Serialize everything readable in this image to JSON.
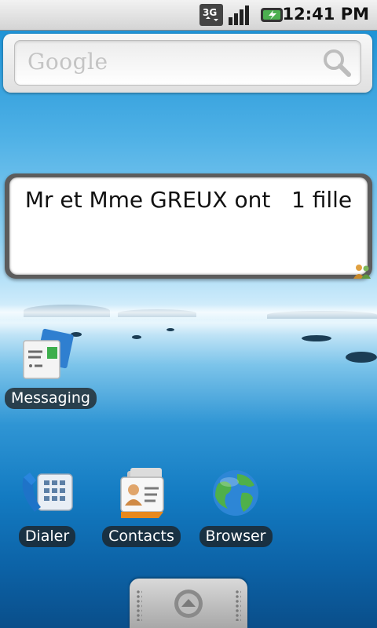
{
  "status_bar": {
    "time": "12:41 PM",
    "network_badge": "3G",
    "icons": [
      "3g-data-icon",
      "signal-strength-icon",
      "battery-charging-icon"
    ]
  },
  "search_widget": {
    "logo_text": "Google",
    "icon": "search-icon"
  },
  "note_widget": {
    "text": "Mr et Mme GREUX ont   1 fille",
    "badge_icon": "people-icon"
  },
  "apps": [
    {
      "label": "Messaging",
      "icon": "messaging-icon"
    },
    {
      "label": "Dialer",
      "icon": "dialer-icon"
    },
    {
      "label": "Contacts",
      "icon": "contacts-icon"
    },
    {
      "label": "Browser",
      "icon": "browser-globe-icon"
    }
  ],
  "drawer": {
    "icon": "arrow-up-icon"
  },
  "colors": {
    "sky": "#1f93d6",
    "sea": "#0c62a6",
    "status_bar": "#e6e6e6",
    "label_bg": "#1e1e1e"
  }
}
